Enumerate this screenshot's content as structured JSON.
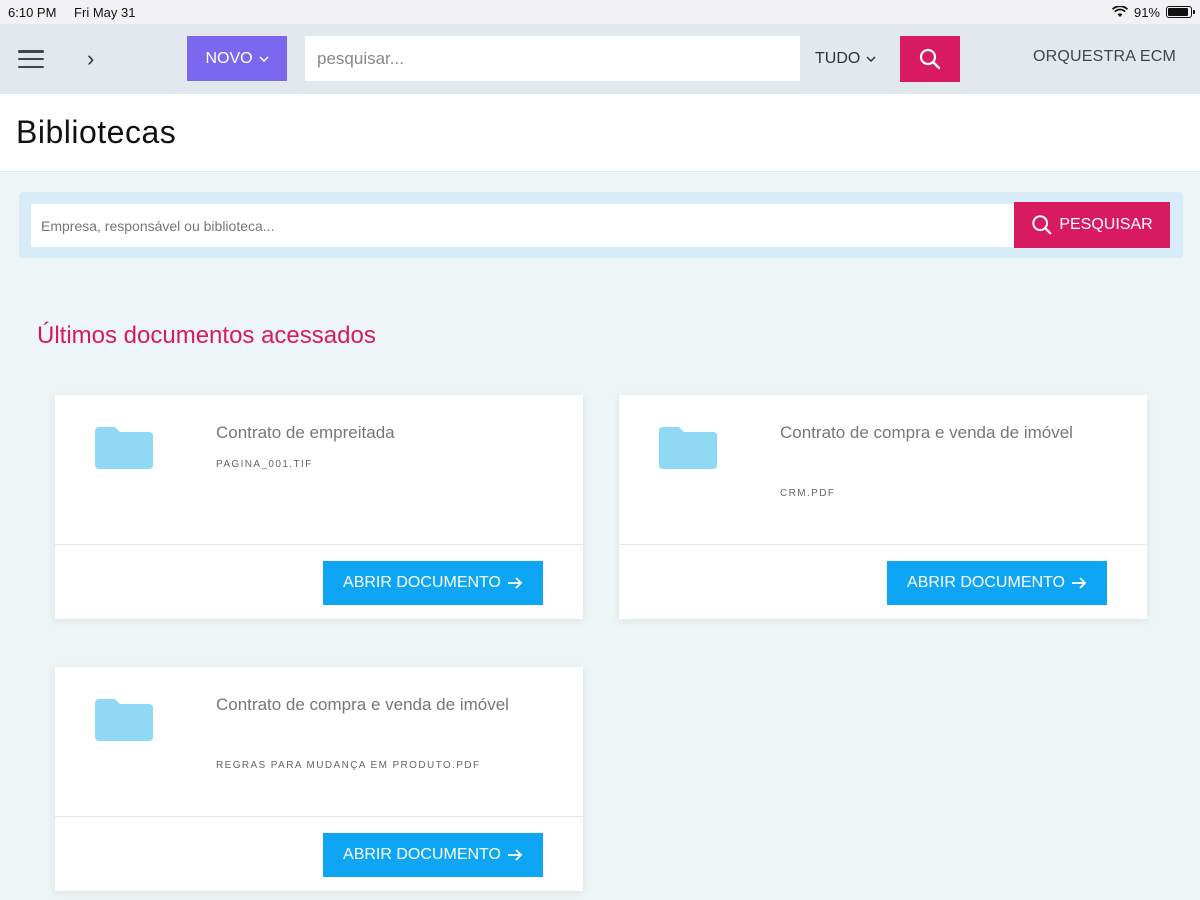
{
  "statusbar": {
    "time": "6:10 PM",
    "date": "Fri May 31",
    "battery": "91%",
    "battery_level": 0.91
  },
  "header": {
    "new_button": "NOVO",
    "search_placeholder": "pesquisar...",
    "scope": "TUDO",
    "brand": "ORQUESTRA ECM"
  },
  "page": {
    "title": "Bibliotecas"
  },
  "library_search": {
    "placeholder": "Empresa, responsável ou biblioteca...",
    "button": "PESQUISAR"
  },
  "recent": {
    "title": "Últimos documentos acessados",
    "documents": [
      {
        "title": "Contrato de empreitada",
        "file": "PAGINA_001.TIF",
        "action": "ABRIR DOCUMENTO"
      },
      {
        "title": "Contrato de compra e venda de imóvel",
        "file": "CRM.PDF",
        "action": "ABRIR DOCUMENTO"
      },
      {
        "title": "Contrato de compra e venda de imóvel",
        "file": "REGRAS PARA MUDANÇA EM PRODUTO.PDF",
        "action": "ABRIR DOCUMENTO"
      }
    ]
  },
  "colors": {
    "accent_pink": "#d81b60",
    "novo_purple": "#7b68ee",
    "action_blue": "#0ea5f5",
    "folder_blue": "#8fd9f5"
  }
}
